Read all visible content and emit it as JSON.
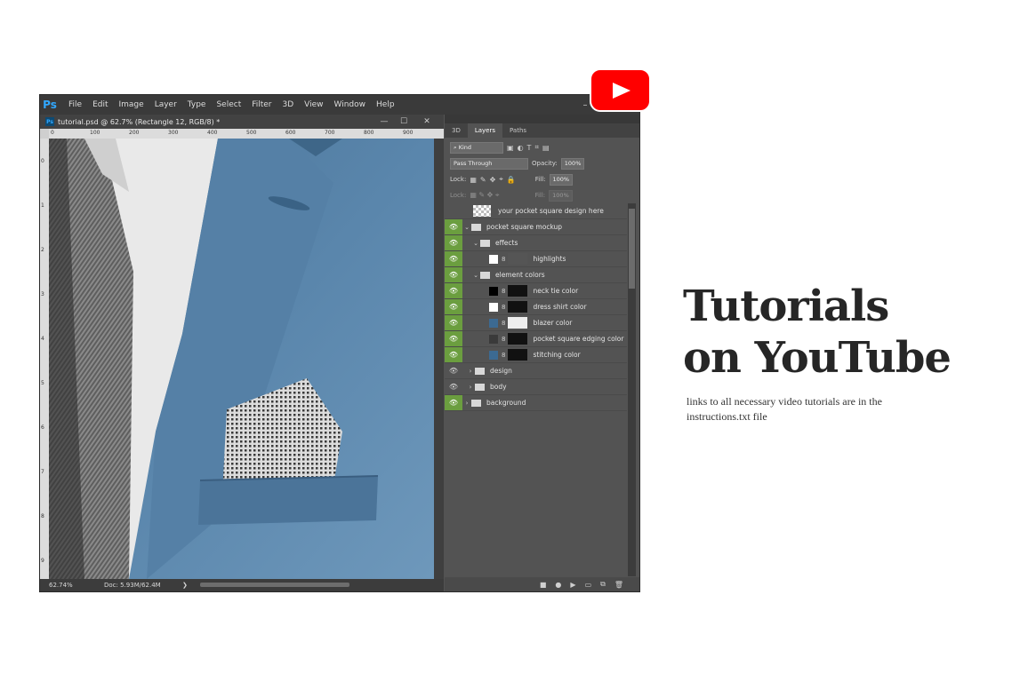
{
  "app": {
    "logo": "Ps",
    "menu": [
      "File",
      "Edit",
      "Image",
      "Layer",
      "Type",
      "Select",
      "Filter",
      "3D",
      "View",
      "Window",
      "Help"
    ],
    "minimize": "–"
  },
  "document": {
    "tab_title": "tutorial.psd @ 62.7% (Rectangle 12, RGB/8) *",
    "ctrl_min": "—",
    "ctrl_max": "☐",
    "ctrl_close": "✕",
    "ruler_top": [
      "0",
      "100",
      "200",
      "300",
      "400",
      "500",
      "600",
      "700",
      "800",
      "900"
    ],
    "ruler_left": [
      "0",
      "1",
      "2",
      "3",
      "4",
      "5",
      "6",
      "7",
      "8",
      "9"
    ],
    "status_zoom": "62.74%",
    "status_doc": "Doc: 5.93M/62.4M",
    "status_arrow": "❯"
  },
  "panel": {
    "tabs": [
      "3D",
      "Layers",
      "Paths"
    ],
    "active_tab": "Layers",
    "filter_kind": "Kind",
    "blend_mode": "Pass Through",
    "opacity_label": "Opacity:",
    "opacity_value": "100%",
    "lock_label": "Lock:",
    "fill_label": "Fill:",
    "fill_value": "100%",
    "layers": [
      {
        "name": "your pocket square design here",
        "visible": false,
        "depth": 0,
        "type": "smart"
      },
      {
        "name": "pocket square mockup",
        "visible": true,
        "depth": 0,
        "type": "group-open"
      },
      {
        "name": "effects",
        "visible": true,
        "depth": 1,
        "type": "group-open"
      },
      {
        "name": "highlights",
        "visible": true,
        "depth": 2,
        "type": "fill",
        "color": "#ffffff"
      },
      {
        "name": "element colors",
        "visible": true,
        "depth": 1,
        "type": "group-open"
      },
      {
        "name": "neck tie color",
        "visible": true,
        "depth": 2,
        "type": "fill",
        "color": "#000000"
      },
      {
        "name": "dress shirt color",
        "visible": true,
        "depth": 2,
        "type": "fill",
        "color": "#ffffff"
      },
      {
        "name": "blazer color",
        "visible": true,
        "depth": 2,
        "type": "fill",
        "color": "#3c6a92"
      },
      {
        "name": "pocket square edging color",
        "visible": true,
        "depth": 2,
        "type": "fill",
        "color": "#3a3a3a"
      },
      {
        "name": "stitching color",
        "visible": true,
        "depth": 2,
        "type": "fill",
        "color": "#3c6a92"
      },
      {
        "name": "design",
        "visible": true,
        "depth": 0,
        "type": "group-closed"
      },
      {
        "name": "body",
        "visible": true,
        "depth": 0,
        "type": "group-closed"
      },
      {
        "name": "background",
        "visible": true,
        "depth": -1,
        "type": "group-closed"
      }
    ]
  },
  "overlay": {
    "headline_line1": "Tutorials",
    "headline_line2": "on YouTube",
    "subtext": "links to all necessary video tutorials are in the instructions.txt file"
  },
  "colors": {
    "youtube_red": "#ff0000",
    "layer_visible_green": "#6b9e3f",
    "ps_blue": "#31a8ff"
  }
}
